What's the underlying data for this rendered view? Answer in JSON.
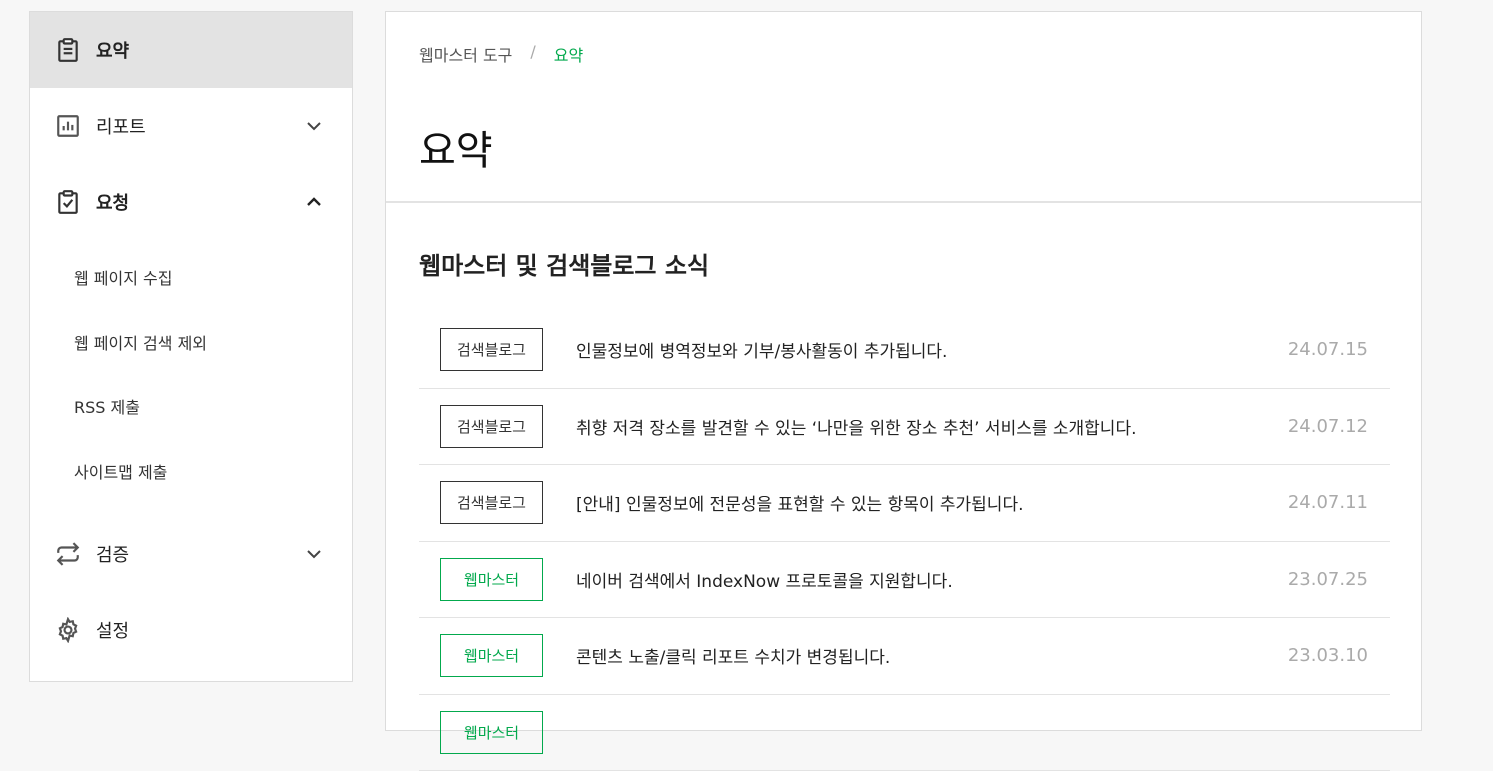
{
  "sidebar": {
    "items": [
      {
        "label": "요약",
        "icon": "clipboard-icon",
        "state": "active"
      },
      {
        "label": "리포트",
        "icon": "chart-icon",
        "state": "collapsed"
      },
      {
        "label": "요청",
        "icon": "clipboard-check-icon",
        "state": "expanded",
        "children": [
          "웹 페이지 수집",
          "웹 페이지 검색 제외",
          "RSS 제출",
          "사이트맵 제출"
        ]
      },
      {
        "label": "검증",
        "icon": "repeat-icon",
        "state": "collapsed"
      },
      {
        "label": "설정",
        "icon": "gear-icon",
        "state": "none"
      }
    ]
  },
  "breadcrumb": {
    "root": "웹마스터 도구",
    "separator": "/",
    "current": "요약"
  },
  "page_title": "요약",
  "news": {
    "title": "웹마스터 및 검색블로그 소식",
    "items": [
      {
        "tag": "검색블로그",
        "title": "인물정보에 병역정보와 기부/봉사활동이 추가됩니다.",
        "date": "24.07.15"
      },
      {
        "tag": "검색블로그",
        "title": "취향 저격 장소를 발견할 수 있는 ‘나만을 위한 장소 추천’ 서비스를 소개합니다.",
        "date": "24.07.12"
      },
      {
        "tag": "검색블로그",
        "title": "[안내] 인물정보에 전문성을 표현할 수 있는 항목이 추가됩니다.",
        "date": "24.07.11"
      },
      {
        "tag": "웹마스터",
        "title": "네이버 검색에서 IndexNow 프로토콜을 지원합니다.",
        "date": "23.07.25"
      },
      {
        "tag": "웹마스터",
        "title": "콘텐츠 노출/클릭 리포트 수치가 변경됩니다.",
        "date": "23.03.10"
      },
      {
        "tag": "웹마스터",
        "title": "",
        "date": ""
      }
    ]
  },
  "colors": {
    "accent": "#03a94d",
    "active_bg": "#e3e3e3",
    "date": "#aaaaaa"
  }
}
